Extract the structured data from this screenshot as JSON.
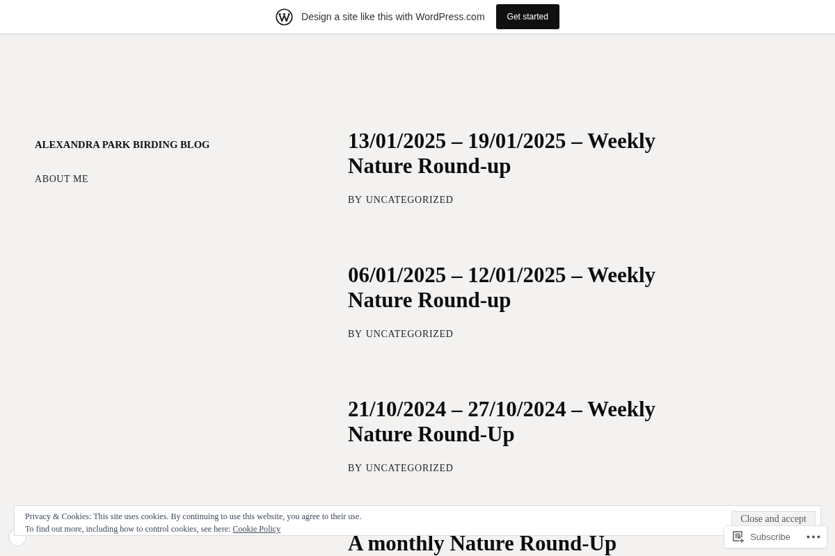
{
  "promo_bar": {
    "text": "Design a site like this with WordPress.com",
    "button": "Get started"
  },
  "site": {
    "title": "ALEXANDRA PARK BIRDING BLOG",
    "nav": [
      {
        "label": "ABOUT ME"
      }
    ]
  },
  "posts": [
    {
      "title": "13/01/2025 – 19/01/2025 – Weekly Nature Round-up",
      "byline": "BY",
      "category": "UNCATEGORIZED"
    },
    {
      "title": "06/01/2025 – 12/01/2025 – Weekly Nature Round-up",
      "byline": "BY",
      "category": "UNCATEGORIZED"
    },
    {
      "title": "21/10/2024 – 27/10/2024 – Weekly Nature Round-Up",
      "byline": "BY",
      "category": "UNCATEGORIZED"
    },
    {
      "title": "A monthly Nature Round-Up"
    }
  ],
  "cookie_banner": {
    "text": "Privacy & Cookies: This site uses cookies. By continuing to use this website, you agree to their use.",
    "more_text": "To find out more, including how to control cookies, see here:",
    "link": "Cookie Policy",
    "button": "Close and accept"
  },
  "subscribe": {
    "label": "Subscribe"
  }
}
